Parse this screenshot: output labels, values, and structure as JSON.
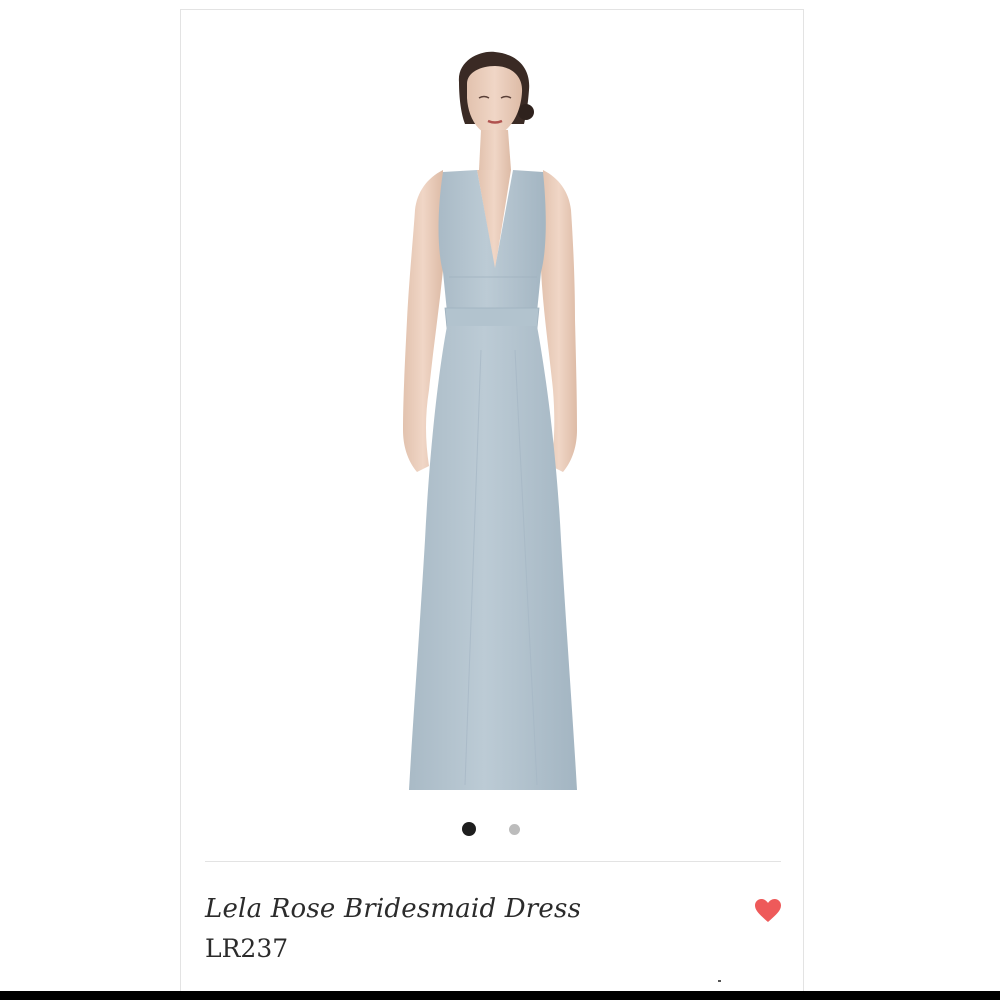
{
  "product": {
    "title": "Lela Rose Bridesmaid Dress",
    "sku": "LR237",
    "favorited": true
  },
  "gallery": {
    "image_count": 2,
    "active_index": 0
  },
  "icons": {
    "favorite": "heart-icon"
  },
  "colors": {
    "dress": "#b7c7d2",
    "heart": "#ee5a5a",
    "active_dot": "#1e1e1e",
    "inactive_dot": "#bcbcbc"
  }
}
